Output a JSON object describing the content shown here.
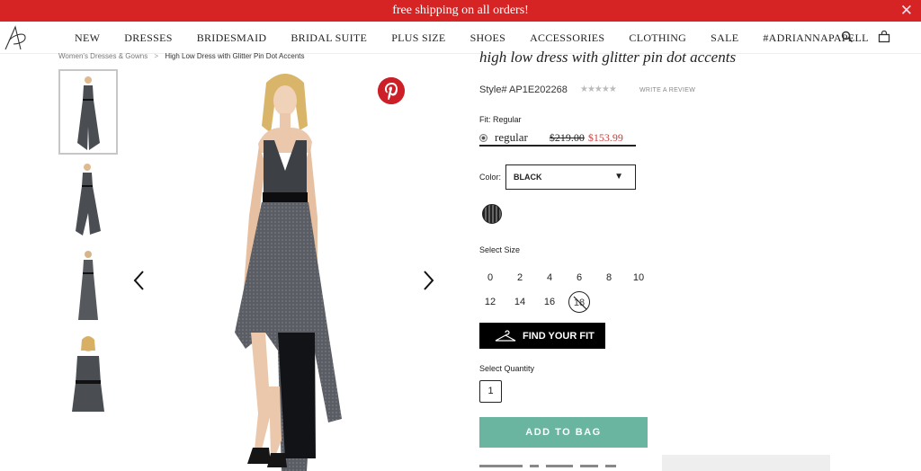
{
  "promo": {
    "text": "free shipping on all orders!",
    "close": "✕"
  },
  "nav": {
    "items": [
      "NEW",
      "DRESSES",
      "BRIDESMAID",
      "BRIDAL SUITE",
      "PLUS SIZE",
      "SHOES",
      "ACCESSORIES",
      "CLOTHING",
      "SALE",
      "#ADRIANNAPAPELL"
    ],
    "icons": [
      "search-icon",
      "bag-icon"
    ]
  },
  "breadcrumb": {
    "parent": "Women's Dresses & Gowns",
    "separator": ">",
    "current": "High Low Dress with Glitter Pin Dot Accents"
  },
  "gallery": {
    "thumbnail_count": 4,
    "active_thumbnail": 1
  },
  "product": {
    "title": "high low dress with glitter pin dot accents",
    "style": "Style# AP1E202268",
    "stars": "★★★★★",
    "rating_stars": 0,
    "write_review": "WRITE A REVIEW",
    "fit_label": "Fit: Regular",
    "fit_option": "regular",
    "price_original": "$219.00",
    "price_sale": "$153.99",
    "color_label": "Color:",
    "color_selected": "BLACK",
    "color_caret": "▼",
    "size_label": "Select Size",
    "sizes": [
      "0",
      "2",
      "4",
      "6",
      "8",
      "10",
      "12",
      "14",
      "16",
      "18"
    ],
    "sold_out_size": "18",
    "find_fit": "FIND YOUR FIT",
    "quantity_label": "Select Quantity",
    "quantity": "1",
    "add_to_bag": "ADD TO BAG"
  },
  "colors": {
    "promo": "#d62323",
    "sale_price": "#d33a3a",
    "add_to_bag": "#69b59f",
    "pinterest": "#cc1f27"
  }
}
